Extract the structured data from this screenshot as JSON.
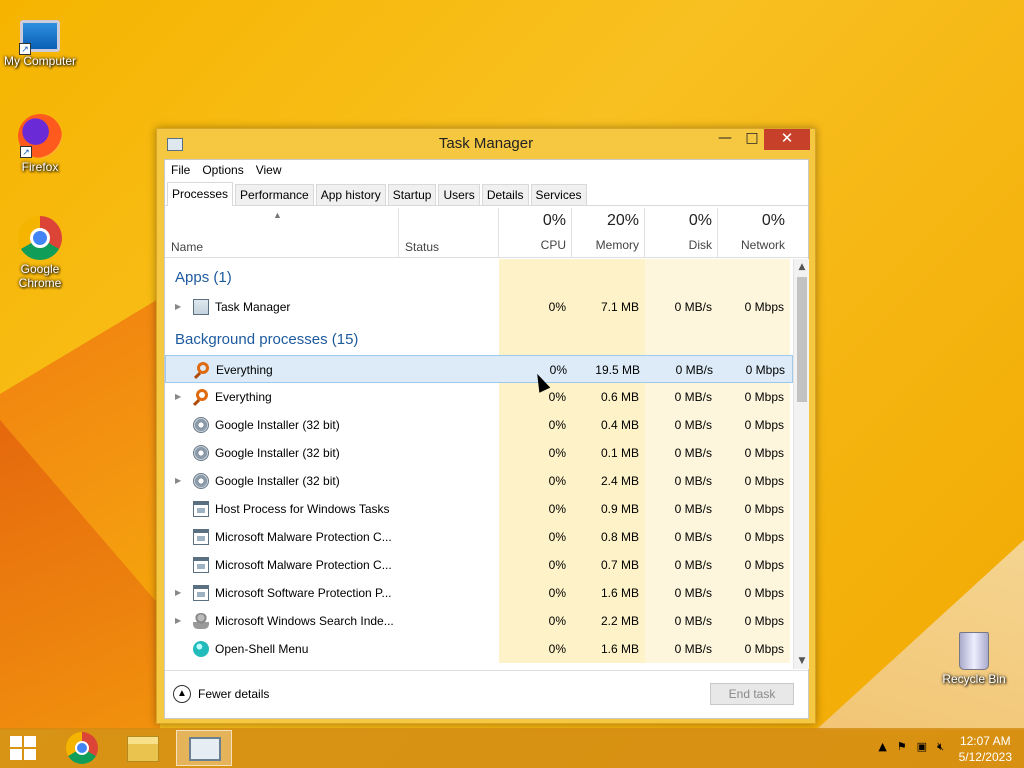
{
  "desktop": {
    "icons": [
      {
        "label": "My Computer"
      },
      {
        "label": "Firefox"
      },
      {
        "label": "Google Chrome"
      },
      {
        "label": "Recycle Bin"
      }
    ]
  },
  "window": {
    "title": "Task Manager",
    "controls": {
      "minimize": "—",
      "maximize": "□",
      "close": "✕"
    },
    "menu": [
      "File",
      "Options",
      "View"
    ],
    "tabs": [
      "Processes",
      "Performance",
      "App history",
      "Startup",
      "Users",
      "Details",
      "Services"
    ],
    "active_tab": "Processes",
    "columns": {
      "name": "Name",
      "status": "Status",
      "cpu": {
        "pct": "0%",
        "label": "CPU"
      },
      "memory": {
        "pct": "20%",
        "label": "Memory"
      },
      "disk": {
        "pct": "0%",
        "label": "Disk"
      },
      "network": {
        "pct": "0%",
        "label": "Network"
      }
    },
    "groups": {
      "apps": "Apps (1)",
      "background": "Background processes (15)"
    },
    "apps": [
      {
        "name": "Task Manager",
        "icon": "task-manager-icon",
        "expandable": true,
        "cpu": "0%",
        "memory": "7.1 MB",
        "disk": "0 MB/s",
        "network": "0 Mbps"
      }
    ],
    "background": [
      {
        "name": "Everything",
        "icon": "magnifier-icon",
        "expandable": false,
        "selected": true,
        "cpu": "0%",
        "memory": "19.5 MB",
        "disk": "0 MB/s",
        "network": "0 Mbps"
      },
      {
        "name": "Everything",
        "icon": "magnifier-icon",
        "expandable": true,
        "cpu": "0%",
        "memory": "0.6 MB",
        "disk": "0 MB/s",
        "network": "0 Mbps"
      },
      {
        "name": "Google Installer (32 bit)",
        "icon": "installer-icon",
        "expandable": false,
        "cpu": "0%",
        "memory": "0.4 MB",
        "disk": "0 MB/s",
        "network": "0 Mbps"
      },
      {
        "name": "Google Installer (32 bit)",
        "icon": "installer-icon",
        "expandable": false,
        "cpu": "0%",
        "memory": "0.1 MB",
        "disk": "0 MB/s",
        "network": "0 Mbps"
      },
      {
        "name": "Google Installer (32 bit)",
        "icon": "installer-icon",
        "expandable": true,
        "cpu": "0%",
        "memory": "2.4 MB",
        "disk": "0 MB/s",
        "network": "0 Mbps"
      },
      {
        "name": "Host Process for Windows Tasks",
        "icon": "window-icon",
        "expandable": false,
        "cpu": "0%",
        "memory": "0.9 MB",
        "disk": "0 MB/s",
        "network": "0 Mbps"
      },
      {
        "name": "Microsoft Malware Protection C...",
        "icon": "window-icon",
        "expandable": false,
        "cpu": "0%",
        "memory": "0.8 MB",
        "disk": "0 MB/s",
        "network": "0 Mbps"
      },
      {
        "name": "Microsoft Malware Protection C...",
        "icon": "window-icon",
        "expandable": false,
        "cpu": "0%",
        "memory": "0.7 MB",
        "disk": "0 MB/s",
        "network": "0 Mbps"
      },
      {
        "name": "Microsoft Software Protection P...",
        "icon": "window-icon",
        "expandable": true,
        "cpu": "0%",
        "memory": "1.6 MB",
        "disk": "0 MB/s",
        "network": "0 Mbps"
      },
      {
        "name": "Microsoft Windows Search Inde...",
        "icon": "person-icon",
        "expandable": true,
        "cpu": "0%",
        "memory": "2.2 MB",
        "disk": "0 MB/s",
        "network": "0 Mbps"
      },
      {
        "name": "Open-Shell Menu",
        "icon": "shell-icon",
        "expandable": false,
        "cpu": "0%",
        "memory": "1.6 MB",
        "disk": "0 MB/s",
        "network": "0 Mbps"
      }
    ],
    "footer": {
      "fewer_details": "Fewer details",
      "end_task": "End task"
    }
  },
  "taskbar": {
    "clock_time": "12:07 AM",
    "clock_date": "5/12/2023"
  }
}
